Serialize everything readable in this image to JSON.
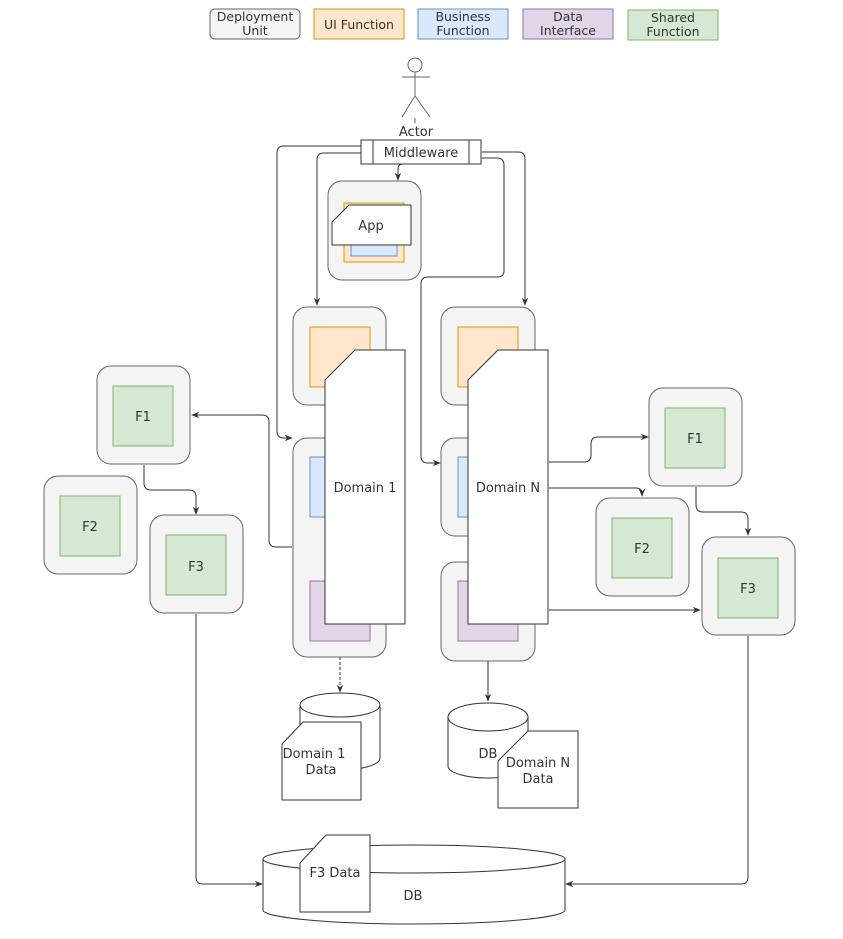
{
  "legend": [
    {
      "id": "deployment-unit",
      "label_lines": [
        "Deployment",
        "Unit"
      ],
      "fill": "#f4f4f4",
      "stroke": "#666666"
    },
    {
      "id": "ui-function",
      "label_lines": [
        "UI Function"
      ],
      "fill": "#ffe6cc",
      "stroke": "#d79b00"
    },
    {
      "id": "business-function",
      "label_lines": [
        "Business",
        "Function"
      ],
      "fill": "#dae8fc",
      "stroke": "#6c8ebf"
    },
    {
      "id": "data-interface",
      "label_lines": [
        "Data",
        "Interface"
      ],
      "fill": "#e1d5e7",
      "stroke": "#9673a6"
    },
    {
      "id": "shared-function",
      "label_lines": [
        "Shared",
        "Function"
      ],
      "fill": "#d5e8d4",
      "stroke": "#82b366"
    }
  ],
  "actor": {
    "label": "Actor"
  },
  "middleware": {
    "label": "Middleware"
  },
  "app": {
    "label": "App"
  },
  "domains": [
    {
      "id": "domain-1",
      "label": "Domain 1",
      "data_label_lines": [
        "Domain 1",
        "Data"
      ]
    },
    {
      "id": "domain-n",
      "label": "Domain N",
      "data_label_lines": [
        "Domain N",
        "Data"
      ],
      "db_label": "DB"
    }
  ],
  "shared_left": [
    {
      "id": "f1",
      "label": "F1"
    },
    {
      "id": "f2",
      "label": "F2"
    },
    {
      "id": "f3",
      "label": "F3"
    }
  ],
  "shared_right": [
    {
      "id": "f1",
      "label": "F1"
    },
    {
      "id": "f2",
      "label": "F2"
    },
    {
      "id": "f3",
      "label": "F3"
    }
  ],
  "shared_db": {
    "label": "DB",
    "data_label": "F3 Data"
  },
  "colors": {
    "line": "#333333",
    "unit_fill": "#f4f4f4",
    "unit_stroke": "#666666"
  }
}
